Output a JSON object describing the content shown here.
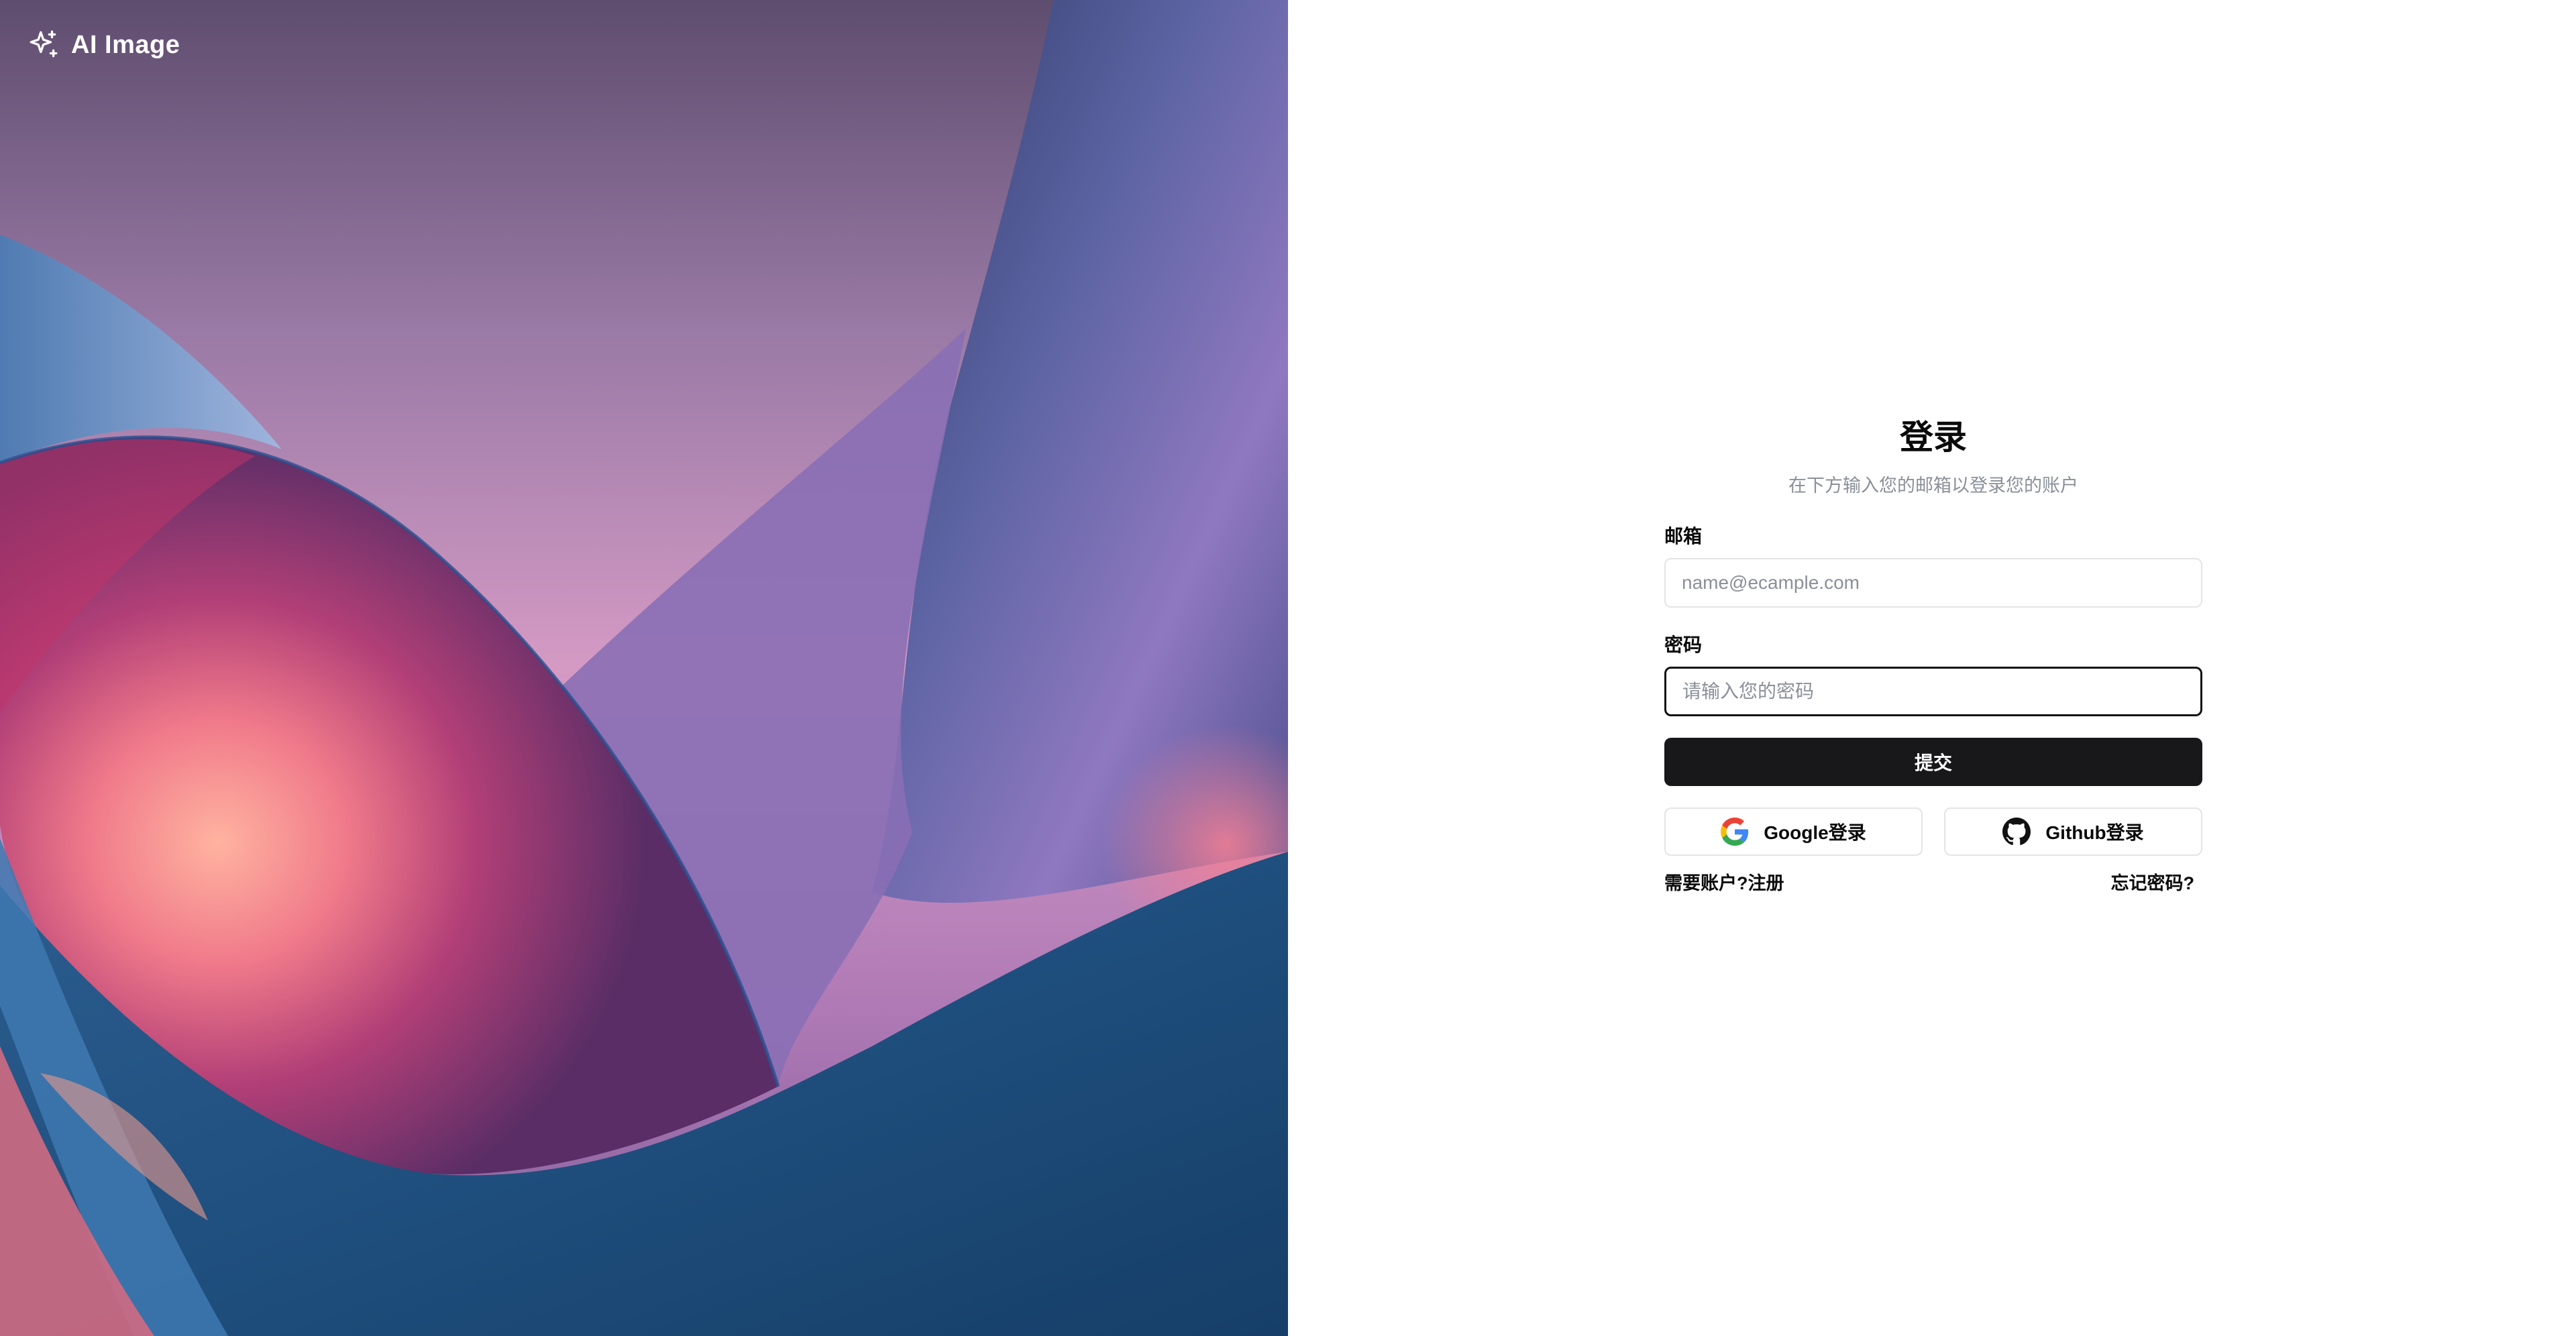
{
  "brand": {
    "name": "AI Image",
    "icon": "sparkles-icon",
    "color": "#ffffff"
  },
  "login": {
    "title": "登录",
    "subtitle": "在下方输入您的邮箱以登录您的账户",
    "email": {
      "label": "邮箱",
      "value": "",
      "placeholder": "name@ecample.com"
    },
    "password": {
      "label": "密码",
      "value": "",
      "placeholder": "请输入您的密码"
    },
    "submit_label": "提交",
    "google_label": "Google登录",
    "github_label": "Github登录",
    "need_account": "需要账户?",
    "register_label": "注册",
    "forgot_label": "忘记密码?"
  },
  "colors": {
    "primary_button": "#18181b",
    "muted_text": "#8a8f98",
    "border": "#e4e4e7"
  }
}
